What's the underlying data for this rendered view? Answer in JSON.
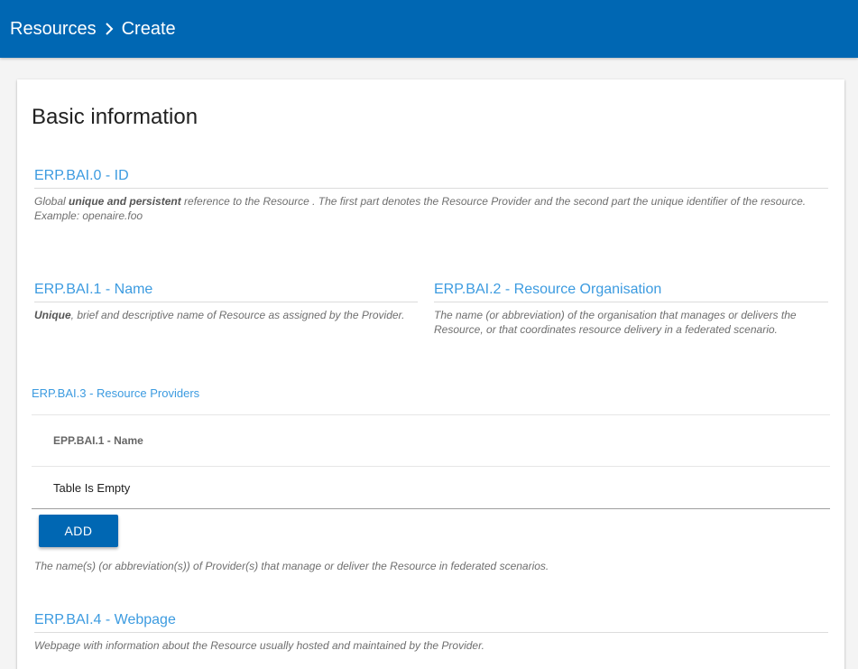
{
  "breadcrumb": {
    "root": "Resources",
    "current": "Create"
  },
  "section": {
    "title": "Basic information"
  },
  "fields": {
    "id": {
      "label": "ERP.BAI.0 - ID",
      "hint_pre": "Global ",
      "hint_bold": "unique and persistent",
      "hint_post": " reference to the Resource . The first part denotes the Resource Provider and the second part the unique identifier of the resource. Example: openaire.foo"
    },
    "name": {
      "label": "ERP.BAI.1 - Name",
      "hint_bold": "Unique",
      "hint_post": ", brief and descriptive name of Resource as assigned by the Provider."
    },
    "organisation": {
      "label": "ERP.BAI.2 - Resource Organisation",
      "hint": "The name (or abbreviation) of the organisation that manages or delivers the Resource, or that coordinates resource delivery in a federated scenario."
    },
    "providers": {
      "label": "ERP.BAI.3 - Resource Providers",
      "table": {
        "header": "EPP.BAI.1 - Name",
        "empty_text": "Table Is Empty"
      },
      "add_label": "ADD",
      "hint": "The name(s) (or abbreviation(s)) of Provider(s) that manage or deliver the Resource in federated scenarios."
    },
    "webpage": {
      "label": "ERP.BAI.4 - Webpage",
      "hint": "Webpage with information about the Resource usually hosted and maintained by the Provider."
    }
  },
  "icons": {
    "breadcrumb_separator": "chevron-right-icon"
  },
  "colors": {
    "primary": "#0067b3",
    "label_blue": "#3c9be0"
  }
}
